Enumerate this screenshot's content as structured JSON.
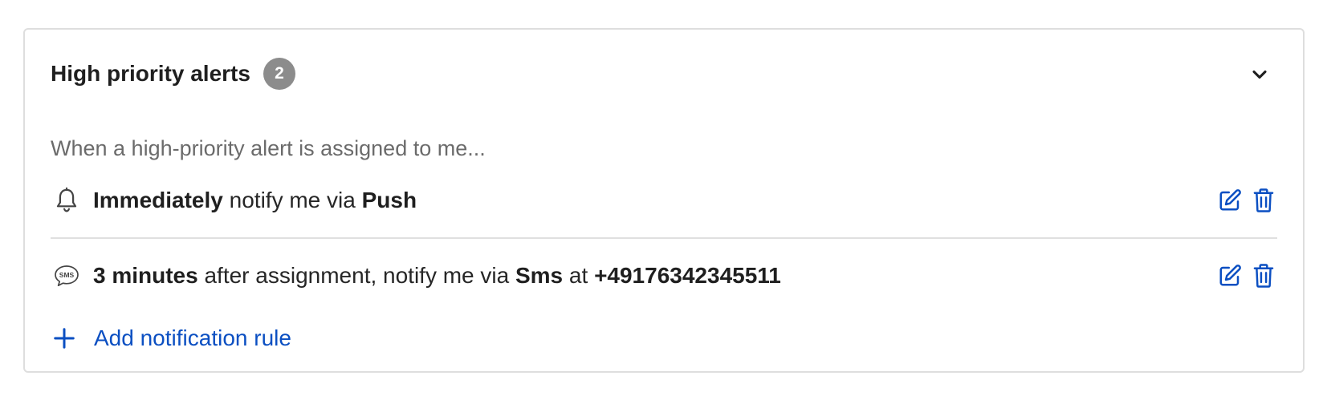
{
  "section": {
    "title": "High priority alerts",
    "count": "2",
    "description": "When a high-priority alert is assigned to me..."
  },
  "rules": [
    {
      "icon": "bell-icon",
      "timing": "Immediately",
      "text_mid": " notify me via ",
      "channel": "Push"
    },
    {
      "icon": "sms-icon",
      "timing": "3 minutes",
      "text_mid": " after assignment, notify me via ",
      "channel": "Sms",
      "text_at": " at ",
      "destination": "+49176342345511"
    }
  ],
  "add_rule": {
    "label": "Add notification rule"
  },
  "colors": {
    "accent": "#0b4fc2",
    "badge": "#8c8c8c",
    "border": "#dedede"
  }
}
